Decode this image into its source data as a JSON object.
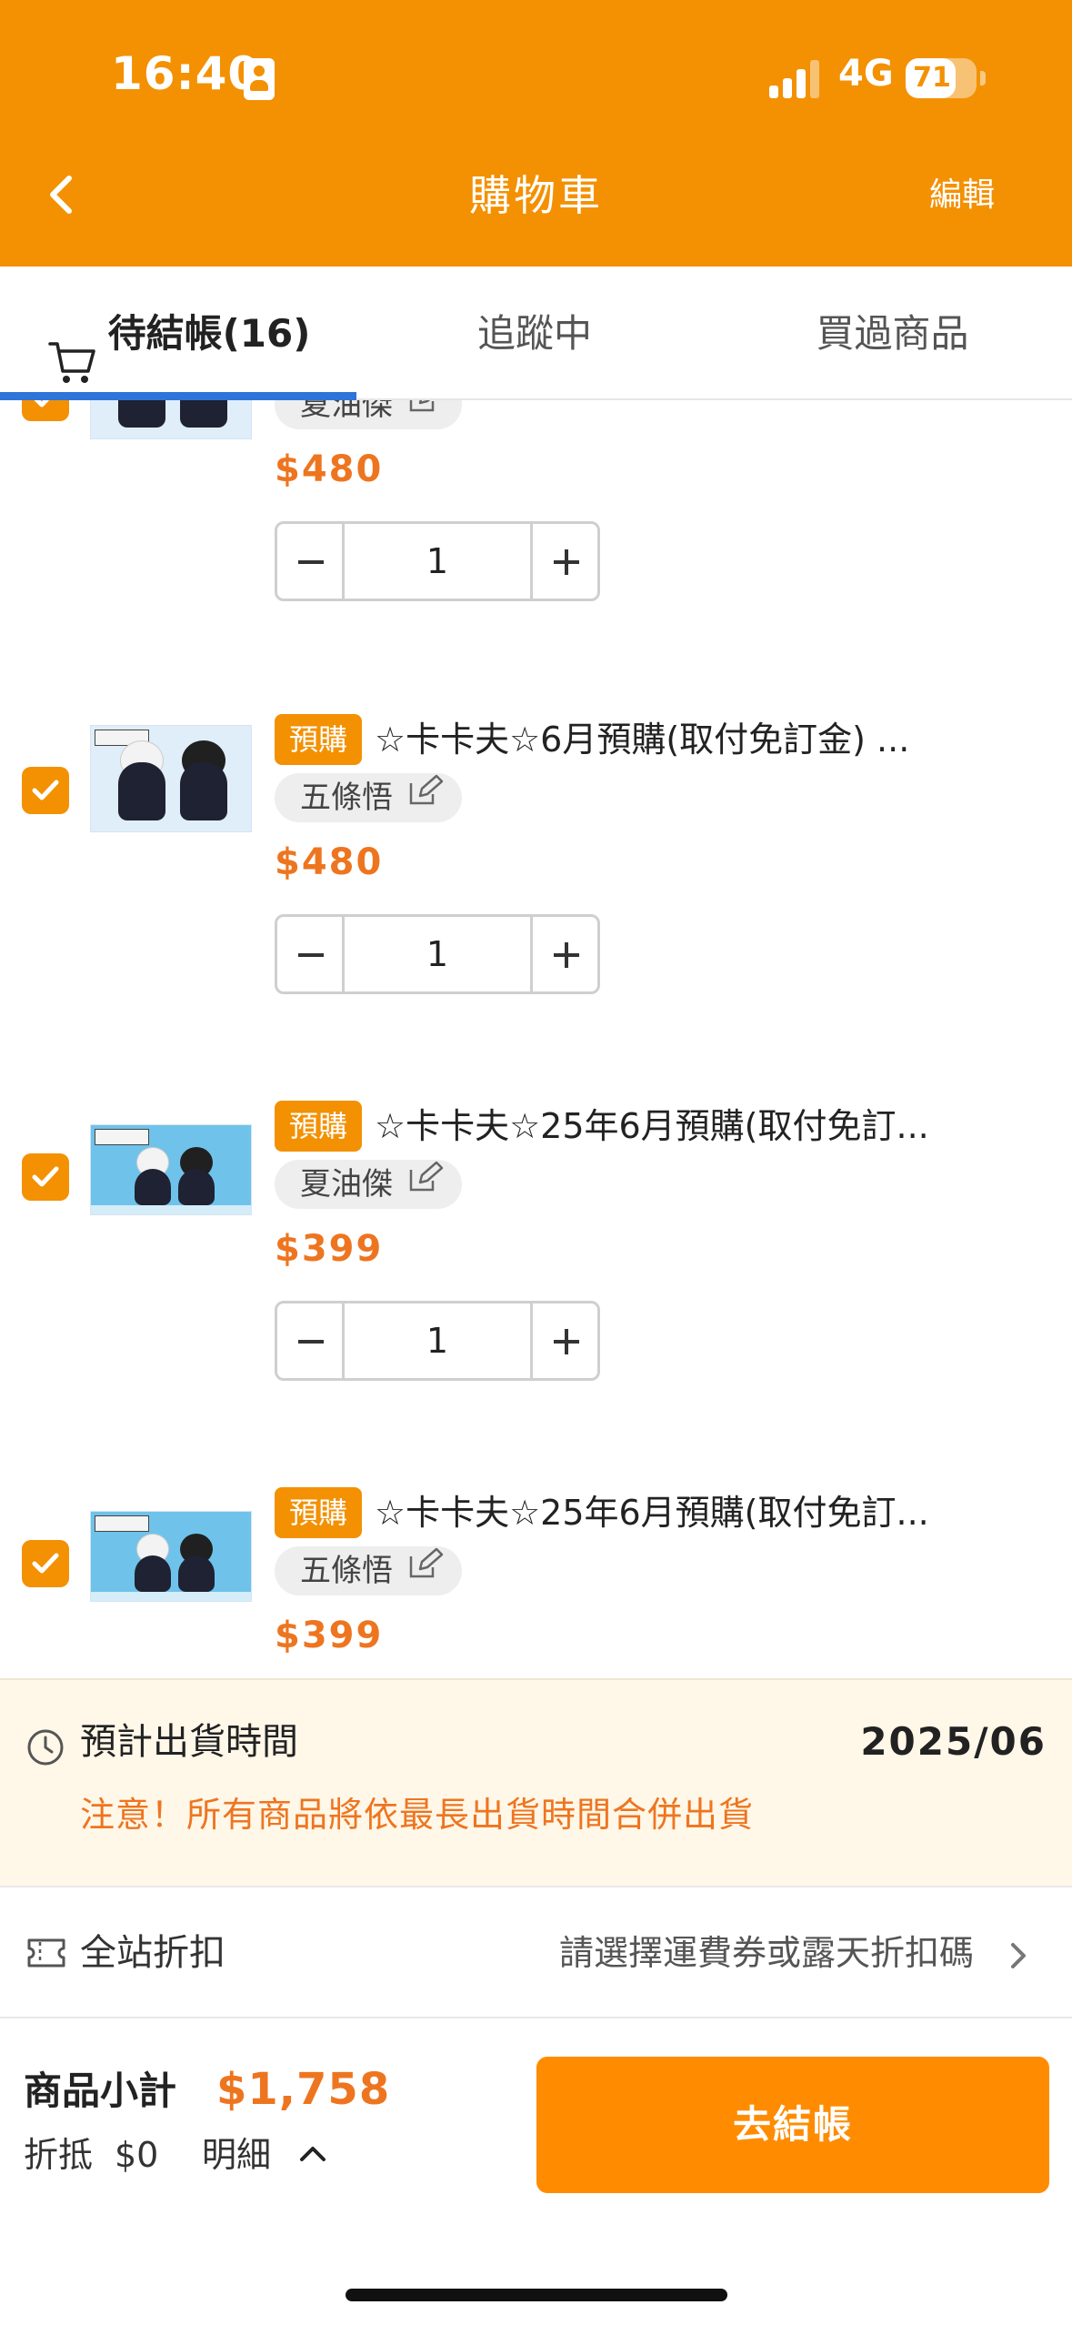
{
  "status_bar": {
    "time": "16:40",
    "network": "4G",
    "battery": "71",
    "battery_level": 0.71
  },
  "header": {
    "title": "購物車",
    "edit_label": "編輯"
  },
  "tabs": [
    {
      "label": "待結帳(16)",
      "active": true
    },
    {
      "label": "追蹤中",
      "active": false
    },
    {
      "label": "買過商品",
      "active": false
    }
  ],
  "items": [
    {
      "checked": true,
      "tag": "",
      "title": "",
      "variant": "夏油傑",
      "price": "$480",
      "quantity": "1"
    },
    {
      "checked": true,
      "tag": "預購",
      "title": "☆卡卡夫☆6月預購(取付免訂金) ...",
      "variant": "五條悟",
      "price": "$480",
      "quantity": "1"
    },
    {
      "checked": true,
      "tag": "預購",
      "title": "☆卡卡夫☆25年6月預購(取付免訂...",
      "variant": "夏油傑",
      "price": "$399",
      "quantity": "1"
    },
    {
      "checked": true,
      "tag": "預購",
      "title": "☆卡卡夫☆25年6月預購(取付免訂...",
      "variant": "五條悟",
      "price": "$399",
      "quantity": "1"
    }
  ],
  "shipping": {
    "label": "預計出貨時間",
    "date": "2025/06",
    "warning": "注意！所有商品將依最長出貨時間合併出貨"
  },
  "discount": {
    "label": "全站折扣",
    "hint": "請選擇運費券或露天折扣碼"
  },
  "footer": {
    "subtotal_label": "商品小計",
    "subtotal_amount": "$1,758",
    "deduct_label": "折抵",
    "deduct_value": "$0",
    "detail_label": "明細",
    "checkout_label": "去結帳"
  },
  "colors": {
    "brand": "#F39103",
    "price": "#EE7520",
    "tab_indicator": "#2E74D9",
    "checkout": "#FF8C00"
  }
}
